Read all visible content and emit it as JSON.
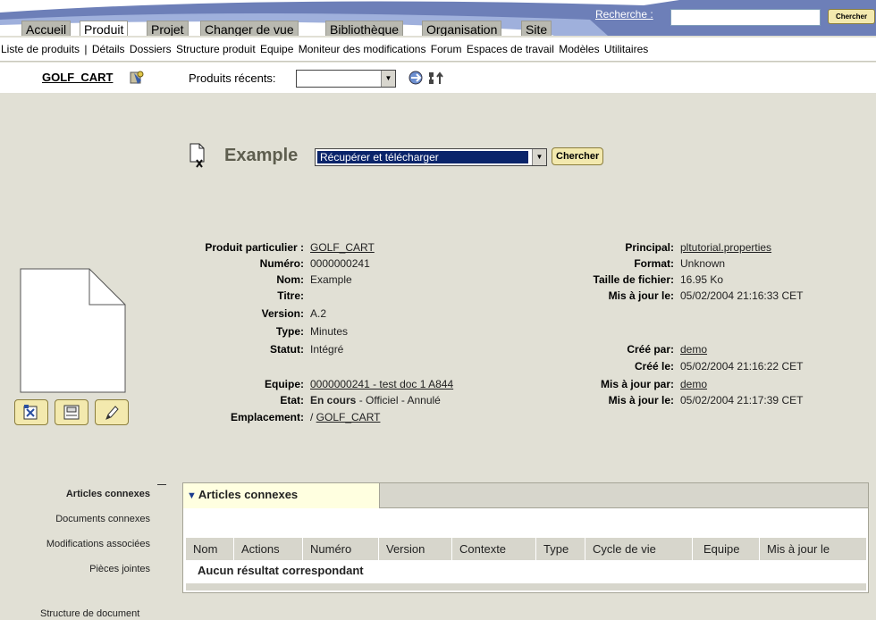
{
  "header": {
    "tabs": [
      {
        "label": "Accueil",
        "active": false
      },
      {
        "label": "Produit",
        "active": true
      },
      {
        "label": "Projet",
        "active": false
      },
      {
        "label": "Changer de vue",
        "active": false
      },
      {
        "label": "Bibliothèque",
        "active": false
      },
      {
        "label": "Organisation",
        "active": false
      },
      {
        "label": "Site",
        "active": false
      }
    ],
    "search_label": "Recherche :",
    "search_value": "",
    "search_button": "Chercher"
  },
  "subnav": {
    "items": [
      "Liste de produits",
      "|",
      "Détails",
      "Dossiers",
      "Structure produit",
      "Equipe",
      "Moniteur des modifications",
      "Forum",
      "Espaces de travail",
      "Modèles",
      "Utilitaires"
    ]
  },
  "context": {
    "product": "GOLF_CART",
    "recent_label": "Produits récents:",
    "recent_value": ""
  },
  "object": {
    "title": "Example",
    "action_value": "Récupérer et télécharger",
    "action_button": "Chercher"
  },
  "attributes_left": {
    "product_label": "Produit particulier :",
    "product_value": "GOLF_CART",
    "number_label": "Numéro:",
    "number_value": "0000000241",
    "name_label": "Nom:",
    "name_value": "Example",
    "title_label": "Titre:",
    "title_value": "",
    "version_label": "Version:",
    "version_value": "A.2",
    "type_label": "Type:",
    "type_value": "Minutes",
    "status_label": "Statut:",
    "status_value": "Intégré",
    "team_label": "Equipe:",
    "team_value": "0000000241 - test doc 1 A844",
    "state_label": "Etat:",
    "state_bold": "En cours",
    "state_rest": " - Officiel - Annulé",
    "location_label": "Emplacement:",
    "location_prefix": "/ ",
    "location_link": "GOLF_CART"
  },
  "attributes_right": {
    "primary_label": "Principal:",
    "primary_value": "pltutorial.properties",
    "format_label": "Format:",
    "format_value": "Unknown",
    "size_label": "Taille de fichier:",
    "size_value": "16.95 Ko",
    "updated_file_label": "Mis à jour le:",
    "updated_file_value": "05/02/2004 21:16:33 CET",
    "created_by_label": "Créé par:",
    "created_by_value": "demo",
    "created_on_label": "Créé le:",
    "created_on_value": "05/02/2004 21:16:22 CET",
    "updated_by_label": "Mis à jour par:",
    "updated_by_value": "demo",
    "updated_on_label": "Mis à jour le:",
    "updated_on_value": "05/02/2004 21:17:39 CET"
  },
  "sidebar": {
    "items": [
      "Articles connexes",
      "Documents connexes",
      "Modifications associées",
      "Pièces jointes"
    ],
    "structure": "Structure de document"
  },
  "panel": {
    "title": "Articles connexes",
    "columns": [
      "Nom",
      "Actions",
      "Numéro",
      "Version",
      "Contexte",
      "Type",
      "Cycle de vie",
      "Equipe",
      "Mis à jour le"
    ],
    "empty_message": "Aucun résultat correspondant"
  }
}
